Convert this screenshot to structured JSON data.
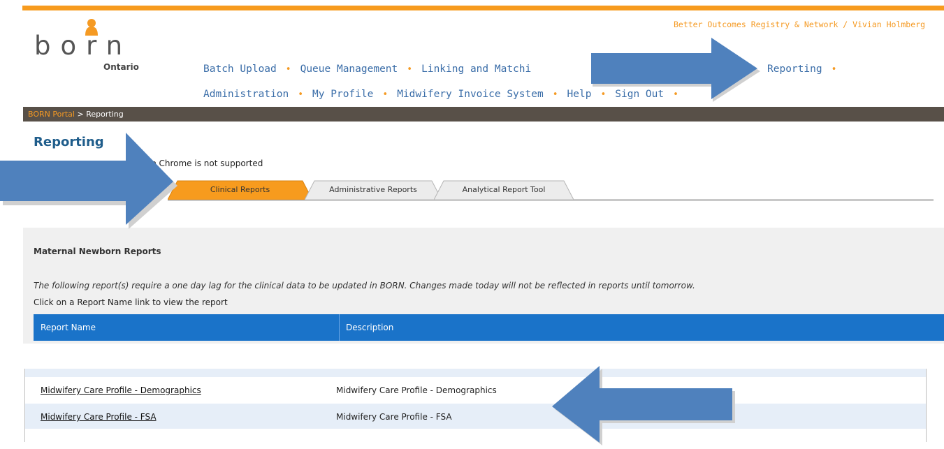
{
  "header": {
    "user_line": "Better Outcomes Registry & Network / Vivian Holmberg",
    "logo": {
      "wordmark": "born",
      "sub": "Ontario"
    }
  },
  "nav": {
    "items": [
      "Batch Upload",
      "Queue Management",
      "Linking and Matchi",
      "Reporting",
      "Administration",
      "My Profile",
      "Midwifery Invoice System",
      "Help",
      "Sign Out"
    ]
  },
  "breadcrumb": {
    "home": "BORN Portal",
    "current": "> Reporting"
  },
  "page": {
    "title": "Reporting",
    "note": "ogle Chrome is not supported"
  },
  "tabs": [
    {
      "label": "Clinical Reports",
      "active": true
    },
    {
      "label": "Administrative Reports",
      "active": false
    },
    {
      "label": "Analytical Report Tool",
      "active": false
    }
  ],
  "section": {
    "title": "Maternal Newborn Reports",
    "lag_note": "The following report(s) require a one day lag for the clinical data to be updated in BORN. Changes made today will not be reflected in reports until tomorrow.",
    "instruction": "Click on a Report Name link to view the report"
  },
  "table": {
    "headers": [
      "Report Name",
      "Description"
    ],
    "rows": [
      {
        "name": "Midwifery Care Profile - Demographics",
        "description": "Midwifery Care Profile - Demographics"
      },
      {
        "name": "Midwifery Care Profile - FSA",
        "description": "Midwifery Care Profile - FSA"
      }
    ]
  },
  "colors": {
    "accent": "#f79b1e",
    "link": "#3a6da8",
    "table_header": "#1a73c9",
    "arrow": "#4f81bd"
  }
}
